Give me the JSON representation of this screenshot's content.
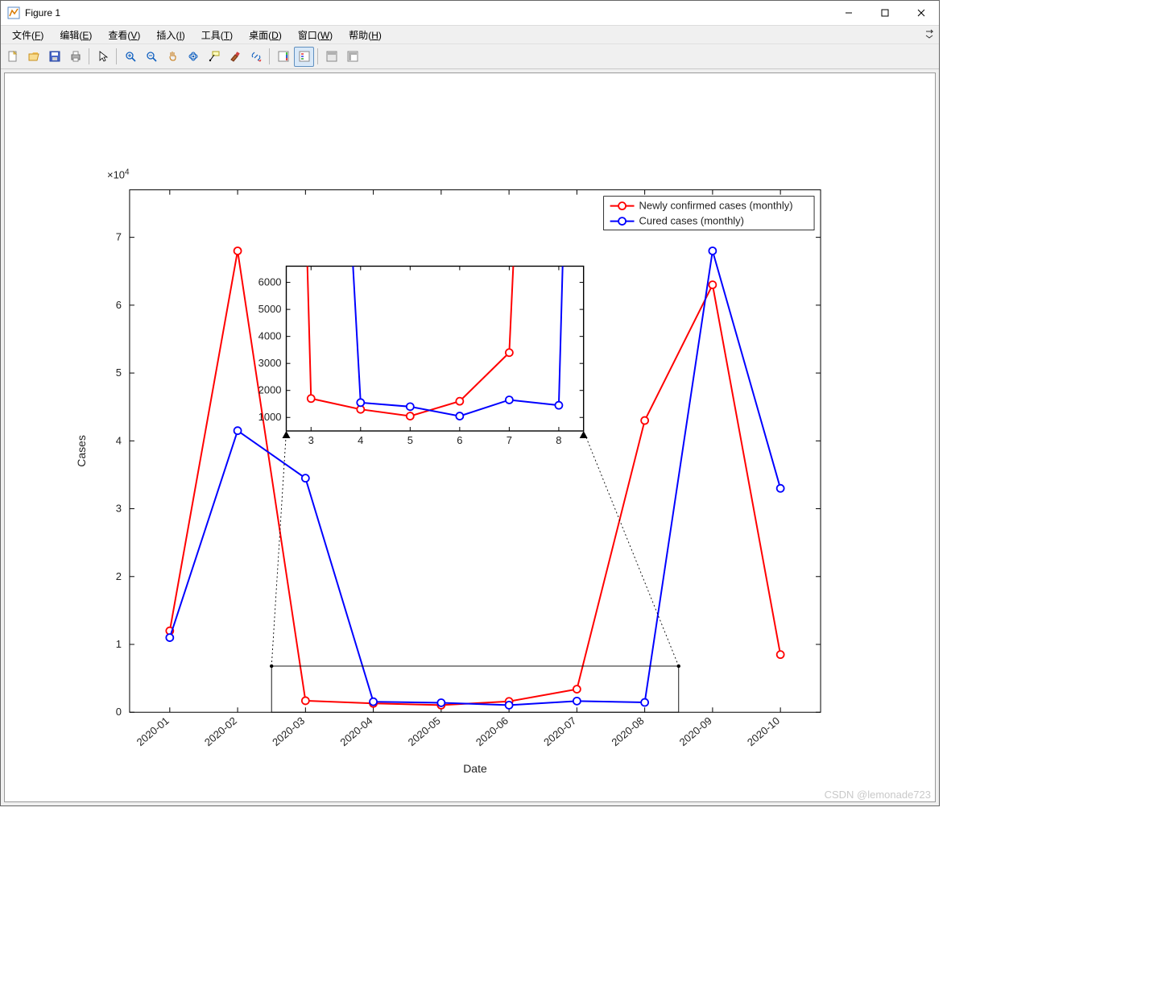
{
  "window": {
    "title": "Figure 1"
  },
  "menu": {
    "file": {
      "label": "文件",
      "mn": "F"
    },
    "edit": {
      "label": "编辑",
      "mn": "E"
    },
    "view": {
      "label": "查看",
      "mn": "V"
    },
    "insert": {
      "label": "插入",
      "mn": "I"
    },
    "tools": {
      "label": "工具",
      "mn": "T"
    },
    "desktop": {
      "label": "桌面",
      "mn": "D"
    },
    "windowm": {
      "label": "窗口",
      "mn": "W"
    },
    "help": {
      "label": "帮助",
      "mn": "H"
    }
  },
  "toolbar": {
    "new": "new-file-icon",
    "open": "open-file-icon",
    "save": "save-icon",
    "print": "print-icon",
    "pointer": "pointer-icon",
    "zoomin": "zoom-in-icon",
    "zoomout": "zoom-out-icon",
    "pan": "pan-icon",
    "rotate": "rotate-icon",
    "datacursor": "data-cursor-icon",
    "brush": "brush-icon",
    "link": "link-icon",
    "colorbar": "colorbar-icon",
    "legend": "legend-icon",
    "hide": "hide-plot-tools-icon",
    "dock": "dock-icon"
  },
  "watermark": "CSDN @lemonade723",
  "chart_data": {
    "type": "line",
    "xlabel": "Date",
    "ylabel": "Cases",
    "y_exponent_label": "×10",
    "y_exponent_value": "4",
    "categories": [
      "2020-01",
      "2020-02",
      "2020-03",
      "2020-04",
      "2020-05",
      "2020-06",
      "2020-07",
      "2020-08",
      "2020-09",
      "2020-10"
    ],
    "y_ticks": [
      0,
      1,
      2,
      3,
      4,
      5,
      6,
      7
    ],
    "ylim": [
      0,
      77000
    ],
    "series": [
      {
        "name": "Newly confirmed cases (monthly)",
        "color": "#ff0000",
        "values": [
          12000,
          68000,
          1700,
          1300,
          1050,
          1600,
          3400,
          43000,
          63000,
          8500
        ]
      },
      {
        "name": "Cured cases (monthly)",
        "color": "#0000ff",
        "values": [
          11000,
          41500,
          34500,
          1550,
          1400,
          1050,
          1650,
          1450,
          68000,
          33000
        ]
      }
    ],
    "legend_position": "northeast",
    "inset": {
      "x_ticks": [
        3,
        4,
        5,
        6,
        7,
        8
      ],
      "y_ticks": [
        1000,
        2000,
        3000,
        4000,
        5000,
        6000
      ],
      "xlim": [
        2.5,
        8.5
      ],
      "ylim": [
        500,
        6600
      ],
      "zoom_region_x": [
        2.5,
        8.5
      ],
      "zoom_region_y": [
        0,
        6800
      ]
    }
  }
}
